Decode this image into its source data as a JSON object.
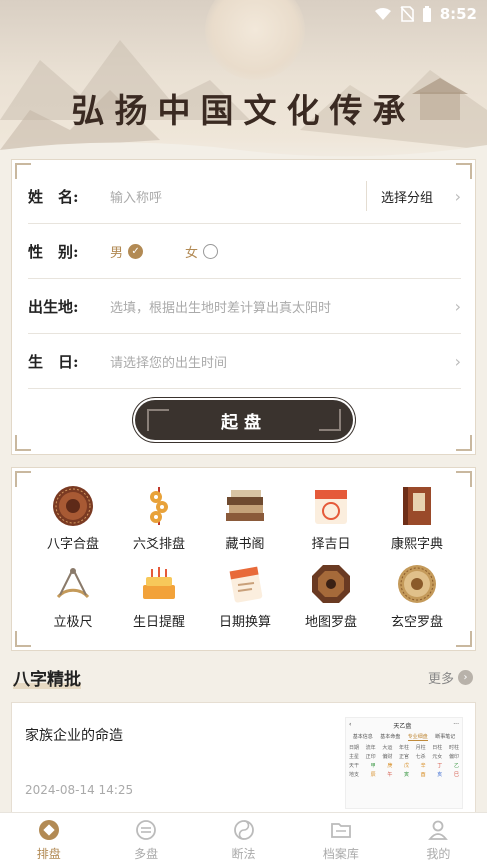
{
  "status_bar": {
    "time": "8:52"
  },
  "banner": {
    "title": "弘扬中国文化传承"
  },
  "form": {
    "name": {
      "label": "姓　名:",
      "placeholder": "输入称呼",
      "group_label": "选择分组"
    },
    "gender": {
      "label": "性　别:",
      "male": "男",
      "female": "女",
      "selected": "男"
    },
    "birthplace": {
      "label": "出生地:",
      "placeholder": "选填，根据出生地时差计算出真太阳时"
    },
    "birthday": {
      "label": "生　日:",
      "placeholder": "请选择您的出生时间"
    },
    "start_button": "起盘"
  },
  "tools": [
    {
      "label": "八字合盘",
      "icon": "bagua-plate-icon"
    },
    {
      "label": "六爻排盘",
      "icon": "coins-icon"
    },
    {
      "label": "藏书阁",
      "icon": "books-icon"
    },
    {
      "label": "择吉日",
      "icon": "calendar-icon"
    },
    {
      "label": "康熙字典",
      "icon": "dictionary-icon"
    },
    {
      "label": "立极尺",
      "icon": "sextant-icon"
    },
    {
      "label": "生日提醒",
      "icon": "birthday-cake-icon"
    },
    {
      "label": "日期换算",
      "icon": "date-convert-icon"
    },
    {
      "label": "地图罗盘",
      "icon": "octagon-compass-icon"
    },
    {
      "label": "玄空罗盘",
      "icon": "round-compass-icon"
    }
  ],
  "section": {
    "title": "八字精批",
    "more": "更多"
  },
  "article": {
    "title": "家族企业的命造",
    "date": "2024-08-14 14:25",
    "thumb_title": "天乙盘",
    "thumb_tabs": [
      "基本信息",
      "基本命盘",
      "专业细盘",
      "断事笔记"
    ],
    "thumb_rows": [
      [
        "日期",
        "流年",
        "大运",
        "年柱",
        "月柱",
        "日柱",
        "时柱"
      ],
      [
        "主星",
        "正印",
        "偏财",
        "正官",
        "七杀",
        "元女",
        "偏印"
      ],
      [
        "天干",
        "甲",
        "庚",
        "戊",
        "辛",
        "丁",
        "乙"
      ],
      [
        "地支",
        "辰",
        "午",
        "寅",
        "酉",
        "亥",
        "巳"
      ]
    ]
  },
  "bottom_nav": [
    {
      "label": "排盘",
      "icon": "plate-icon",
      "active": true
    },
    {
      "label": "多盘",
      "icon": "multi-plate-icon",
      "active": false
    },
    {
      "label": "断法",
      "icon": "yin-yang-icon",
      "active": false
    },
    {
      "label": "档案库",
      "icon": "folder-icon",
      "active": false
    },
    {
      "label": "我的",
      "icon": "user-icon",
      "active": false
    }
  ],
  "colors": {
    "accent": "#b28a54",
    "button_dark": "#3a332e",
    "background": "#f3efe7"
  }
}
